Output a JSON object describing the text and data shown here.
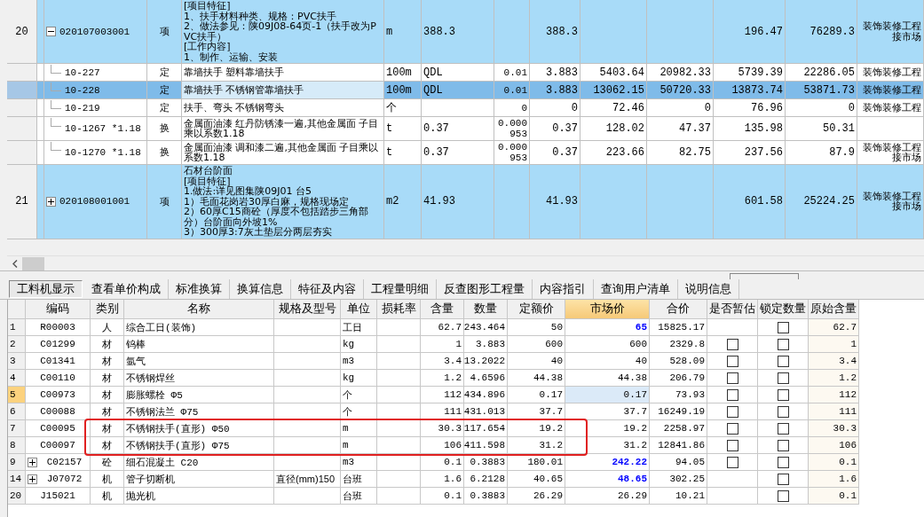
{
  "bill_items": {
    "rows": [
      {
        "number": "20",
        "kind": "bill",
        "expanded": true,
        "selected": false,
        "code": "020107003001",
        "type": "项",
        "description": "[项目特征]\n1、扶手材料种类、规格：PVC扶手\n2、做法参见：陕09J08-64页-1（扶手改为PVC扶手）\n[工作内容]\n1、制作、运输、安装",
        "unit": "m",
        "column_7": "388.3",
        "column_9": "388.3",
        "column_12": "196.47",
        "column_13": "76289.3",
        "category": "装饰装修工程接市场"
      },
      {
        "kind": "quota",
        "selected": false,
        "code": "10-227",
        "type": "定",
        "description": "靠墙扶手 塑料靠墙扶手",
        "unit": "100m",
        "column_7": "QDL",
        "column_8": "0.01",
        "column_9": "3.883",
        "column_10": "5403.64",
        "column_11": "20982.33",
        "column_12": "5739.39",
        "column_13": "22286.05",
        "category": "装饰装修工程"
      },
      {
        "kind": "quota",
        "selected": true,
        "code": "10-228",
        "type": "定",
        "description": "靠墙扶手 不锈钢管靠墙扶手",
        "unit": "100m",
        "column_7": "QDL",
        "column_8": "0.01",
        "column_9": "3.883",
        "column_10": "13062.15",
        "column_11": "50720.33",
        "column_12": "13873.74",
        "column_13": "53871.73",
        "category": "装饰装修工程"
      },
      {
        "kind": "quota",
        "selected": false,
        "code": "10-219",
        "type": "定",
        "description": "扶手、弯头 不锈钢弯头",
        "unit": "个",
        "column_8": "0",
        "column_9": "0",
        "column_10": "72.46",
        "column_11": "0",
        "column_12": "76.96",
        "column_13": "0",
        "category": "装饰装修工程"
      },
      {
        "kind": "quota",
        "selected": false,
        "code": "10-1267 *1.18",
        "type": "换",
        "description": "金属面油漆 红丹防锈漆一遍,其他金属面 子目乘以系数1.18",
        "unit": "t",
        "column_7": "0.37",
        "column_8": "0.000953",
        "column_9": "0.37",
        "column_10": "128.02",
        "column_11": "47.37",
        "column_12": "135.98",
        "column_13": "50.31"
      },
      {
        "kind": "quota",
        "selected": false,
        "code": "10-1270 *1.18",
        "type": "换",
        "description": "金属面油漆 调和漆二遍,其他金属面 子目乘以系数1.18",
        "unit": "t",
        "column_7": "0.37",
        "column_8": "0.000953",
        "column_9": "0.37",
        "column_10": "223.66",
        "column_11": "82.75",
        "column_12": "237.56",
        "column_13": "87.9",
        "category": "装饰装修工程接市场"
      },
      {
        "number": "21",
        "kind": "bill",
        "expanded": false,
        "selected": false,
        "code": "020108001001",
        "type": "项",
        "description": "石材台阶面\n[项目特征]\n1.做法:详见图集陕09J01 台5\n1）毛面花岗岩30厚白麻，规格现场定\n2）60厚C15商砼（厚度不包括踏步三角部分）台阶面向外坡1%\n3）300厚3:7灰土垫层分两层夯实",
        "unit": "m2",
        "column_7": "41.93",
        "column_9": "41.93",
        "column_12": "601.58",
        "column_13": "25224.25",
        "category": "装饰装修工程接市场"
      }
    ]
  },
  "tabs": [
    {
      "label": "工料机显示",
      "selected": true
    },
    {
      "label": "查看单价构成",
      "selected": false
    },
    {
      "label": "标准换算",
      "selected": false
    },
    {
      "label": "换算信息",
      "selected": false
    },
    {
      "label": "特征及内容",
      "selected": false
    },
    {
      "label": "工程量明细",
      "selected": false
    },
    {
      "label": "反查图形工程量",
      "selected": false
    },
    {
      "label": "内容指引",
      "selected": false
    },
    {
      "label": "查询用户清单",
      "selected": false
    },
    {
      "label": "说明信息",
      "selected": false
    }
  ],
  "materials": {
    "columns": [
      {
        "label": "编码",
        "active": false
      },
      {
        "label": "类别",
        "active": false
      },
      {
        "label": "名称",
        "active": false
      },
      {
        "label": "规格及型号",
        "active": false
      },
      {
        "label": "单位",
        "active": false
      },
      {
        "label": "损耗率",
        "active": false
      },
      {
        "label": "含量",
        "active": false
      },
      {
        "label": "数量",
        "active": false
      },
      {
        "label": "定额价",
        "active": false
      },
      {
        "label": "市场价",
        "active": true
      },
      {
        "label": "合价",
        "active": false
      },
      {
        "label": "是否暂估",
        "active": false
      },
      {
        "label": "锁定数量",
        "active": false
      },
      {
        "label": "原始含量",
        "active": false
      }
    ],
    "rows": [
      {
        "number": "1",
        "code": "R00003",
        "category": "人",
        "name": "综合工日(装饰)",
        "unit": "工日",
        "content": "62.7",
        "quantity": "243.464",
        "quota_price": "50",
        "market_price": "65",
        "price_changed": true,
        "total": "15825.17",
        "locked": false,
        "original_content": "62.7",
        "selected": false,
        "highlighted": false
      },
      {
        "number": "2",
        "code": "C01299",
        "category": "材",
        "name": "钨棒",
        "unit": "kg",
        "content": "1",
        "quantity": "3.883",
        "quota_price": "600",
        "market_price": "600",
        "price_changed": false,
        "total": "2329.8",
        "estimate_checked": false,
        "locked": false,
        "original_content": "1",
        "selected": false,
        "highlighted": false
      },
      {
        "number": "3",
        "code": "C01341",
        "category": "材",
        "name": "氩气",
        "unit": "m3",
        "content": "3.4",
        "quantity": "13.2022",
        "quota_price": "40",
        "market_price": "40",
        "price_changed": false,
        "total": "528.09",
        "estimate_checked": false,
        "locked": false,
        "original_content": "3.4",
        "selected": false,
        "highlighted": false
      },
      {
        "number": "4",
        "code": "C00110",
        "category": "材",
        "name": "不锈钢焊丝",
        "unit": "kg",
        "content": "1.2",
        "quantity": "4.6596",
        "quota_price": "44.38",
        "market_price": "44.38",
        "price_changed": false,
        "total": "206.79",
        "estimate_checked": false,
        "locked": false,
        "original_content": "1.2",
        "selected": false,
        "highlighted": false
      },
      {
        "number": "5",
        "code": "C00973",
        "category": "材",
        "name": "膨胀螺栓 Φ5",
        "unit": "个",
        "content": "112",
        "quantity": "434.896",
        "quota_price": "0.17",
        "market_price": "0.17",
        "price_changed": false,
        "total": "73.93",
        "estimate_checked": false,
        "locked": false,
        "original_content": "112",
        "selected": true,
        "highlighted": false
      },
      {
        "number": "6",
        "code": "C00088",
        "category": "材",
        "name": "不锈钢法兰 Φ75",
        "unit": "个",
        "content": "111",
        "quantity": "431.013",
        "quota_price": "37.7",
        "market_price": "37.7",
        "price_changed": false,
        "total": "16249.19",
        "estimate_checked": false,
        "locked": false,
        "original_content": "111",
        "selected": false,
        "highlighted": false
      },
      {
        "number": "7",
        "code": "C00095",
        "category": "材",
        "name": "不锈钢扶手(直形) Φ50",
        "unit": "m",
        "content": "30.3",
        "quantity": "117.654",
        "quota_price": "19.2",
        "market_price": "19.2",
        "price_changed": false,
        "total": "2258.97",
        "estimate_checked": false,
        "locked": false,
        "original_content": "30.3",
        "selected": false,
        "highlighted": true
      },
      {
        "number": "8",
        "code": "C00097",
        "category": "材",
        "name": "不锈钢扶手(直形) Φ75",
        "unit": "m",
        "content": "106",
        "quantity": "411.598",
        "quota_price": "31.2",
        "market_price": "31.2",
        "price_changed": false,
        "total": "12841.86",
        "estimate_checked": false,
        "locked": false,
        "original_content": "106",
        "selected": false,
        "highlighted": true
      },
      {
        "number": "9",
        "code": "C02157",
        "expanded": false,
        "category": "砼",
        "name": "细石混凝土 C20",
        "unit": "m3",
        "content": "0.1",
        "quantity": "0.3883",
        "quota_price": "180.01",
        "market_price": "242.22",
        "price_changed": true,
        "total": "94.05",
        "estimate_checked": false,
        "locked": false,
        "original_content": "0.1",
        "selected": false,
        "highlighted": false
      },
      {
        "number": "14",
        "code": "J07072",
        "expanded": false,
        "category": "机",
        "name": "管子切断机",
        "spec": "直径(mm)150",
        "unit": "台班",
        "content": "1.6",
        "quantity": "6.2128",
        "quota_price": "40.65",
        "market_price": "48.65",
        "price_changed": true,
        "total": "302.25",
        "locked": false,
        "original_content": "1.6",
        "selected": false,
        "highlighted": false
      },
      {
        "number": "20",
        "code": "J15021",
        "category": "机",
        "name": "抛光机",
        "unit": "台班",
        "content": "0.1",
        "quantity": "0.3883",
        "quota_price": "26.29",
        "market_price": "26.29",
        "price_changed": false,
        "total": "10.21",
        "locked": false,
        "original_content": "0.1",
        "selected": false,
        "highlighted": false
      }
    ]
  }
}
